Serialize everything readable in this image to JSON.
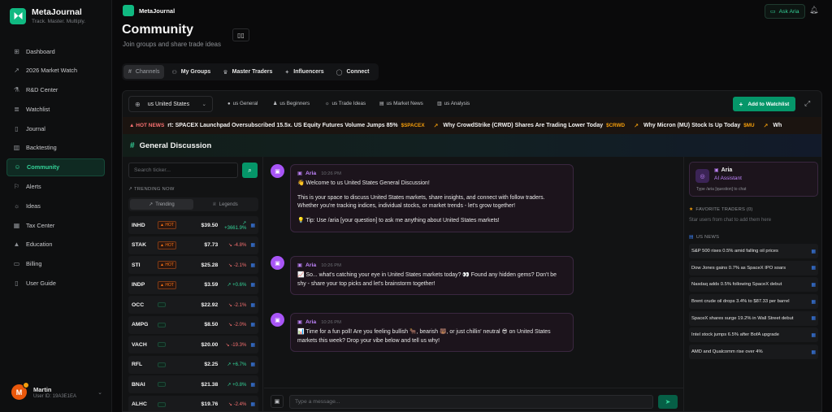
{
  "brand": {
    "name": "MetaJournal",
    "tagline": "Track. Master. Multiply."
  },
  "nav": [
    {
      "label": "Dashboard",
      "icon": "grid-icon",
      "glyph": "⊞"
    },
    {
      "label": "2026 Market Watch",
      "icon": "trend-icon",
      "glyph": "↗"
    },
    {
      "label": "R&D Center",
      "icon": "lab-icon",
      "glyph": "⚗"
    },
    {
      "label": "Watchlist",
      "icon": "list-icon",
      "glyph": "≣"
    },
    {
      "label": "Journal",
      "icon": "book-icon",
      "glyph": "▯"
    },
    {
      "label": "Backtesting",
      "icon": "bar-chart-icon",
      "glyph": "▥"
    },
    {
      "label": "Community",
      "icon": "users-icon",
      "glyph": "☺",
      "active": true
    },
    {
      "label": "Alerts",
      "icon": "bell-icon",
      "glyph": "⚐"
    },
    {
      "label": "Ideas",
      "icon": "bulb-icon",
      "glyph": "☼"
    },
    {
      "label": "Tax Center",
      "icon": "calculator-icon",
      "glyph": "▦"
    },
    {
      "label": "Education",
      "icon": "grad-cap-icon",
      "glyph": "▲"
    },
    {
      "label": "Billing",
      "icon": "card-icon",
      "glyph": "▭"
    },
    {
      "label": "User Guide",
      "icon": "guide-icon",
      "glyph": "▯"
    }
  ],
  "user": {
    "initial": "M",
    "name": "Martin",
    "id": "User ID: 19A3E1EA"
  },
  "topbar": {
    "app_name": "MetaJournal",
    "ask_aria": "Ask Aria"
  },
  "page": {
    "title": "Community",
    "subtitle": "Join groups and share trade ideas"
  },
  "tabs": [
    {
      "label": "Channels",
      "glyph": "#",
      "active": true
    },
    {
      "label": "My Groups",
      "glyph": "⚇"
    },
    {
      "label": "Master Traders",
      "glyph": "♛"
    },
    {
      "label": "Influencers",
      "glyph": "✦"
    },
    {
      "label": "Connect",
      "glyph": "◯"
    }
  ],
  "filters": {
    "country": "us United States",
    "channels": [
      {
        "label": "us General",
        "glyph": "●"
      },
      {
        "label": "us Beginners",
        "glyph": "♟"
      },
      {
        "label": "us Trade Ideas",
        "glyph": "☼"
      },
      {
        "label": "us Market News",
        "glyph": "▤"
      },
      {
        "label": "us Analysis",
        "glyph": "▥"
      }
    ],
    "add_watchlist": "Add to Watchlist"
  },
  "ticker": {
    "hot_label": "HOT NEWS",
    "items": [
      {
        "text": "rt: SPACEX Launchpad Oversubscribed 15.5x. US Equity Futures Volume Jumps 85%",
        "sym": "$SPACEX"
      },
      {
        "text": "Why CrowdStrike (CRWD) Shares Are Trading Lower Today",
        "sym": "$CRWD"
      },
      {
        "text": "Why Micron (MU) Stock Is Up Today",
        "sym": "$MU"
      },
      {
        "text": "Wh",
        "sym": ""
      }
    ]
  },
  "discussion": {
    "title": "General Discussion"
  },
  "search": {
    "placeholder": "Search ticker..."
  },
  "trending": {
    "label": "TRENDING NOW",
    "toggle": [
      "Trending",
      "Legends"
    ],
    "rows": [
      {
        "sym": "INHD",
        "badge": "HOT",
        "price": "$39.50",
        "change": "+3661.9%",
        "dir": "up"
      },
      {
        "sym": "STAK",
        "badge": "HOT",
        "price": "$7.73",
        "change": "-4.8%",
        "dir": "down"
      },
      {
        "sym": "STI",
        "badge": "HOT",
        "price": "$25.28",
        "change": "-2.1%",
        "dir": "down"
      },
      {
        "sym": "INDP",
        "badge": "HOT",
        "price": "$3.59",
        "change": "+0.6%",
        "dir": "up"
      },
      {
        "sym": "OCC",
        "badge": "trend",
        "price": "$22.92",
        "change": "-2.1%",
        "dir": "down"
      },
      {
        "sym": "AMPG",
        "badge": "trend",
        "price": "$8.50",
        "change": "-2.0%",
        "dir": "down"
      },
      {
        "sym": "VACH",
        "badge": "trend",
        "price": "$20.00",
        "change": "-19.3%",
        "dir": "down"
      },
      {
        "sym": "RFL",
        "badge": "trend",
        "price": "$2.25",
        "change": "+6.7%",
        "dir": "up"
      },
      {
        "sym": "BNAI",
        "badge": "trend",
        "price": "$21.38",
        "change": "+0.8%",
        "dir": "up"
      },
      {
        "sym": "ALHC",
        "badge": "trend",
        "price": "$19.76",
        "change": "-2.4%",
        "dir": "down"
      }
    ]
  },
  "messages": [
    {
      "name": "Aria",
      "time": "10:26 PM",
      "paragraphs": [
        "👋 Welcome to us United States General Discussion!",
        "This is your space to discuss United States markets, share insights, and connect with follow traders. Whether you're tracking indices, individual stocks, or market trends - let's grow together!",
        "💡 Tip: Use /aria [your question] to ask me anything about United States markets!"
      ]
    },
    {
      "name": "Aria",
      "time": "10:26 PM",
      "paragraphs": [
        "📈 So... what's catching your eye in United States markets today? 👀 Found any hidden gems? Don't be shy - share your top picks and let's brainstorm together!"
      ]
    },
    {
      "name": "Aria",
      "time": "10:26 PM",
      "paragraphs": [
        "📊 Time for a fun poll! Are you feeling bullish 🐂, bearish 🐻, or just chillin' neutral 😎 on United States markets this week? Drop your vibe below and tell us why!"
      ]
    }
  ],
  "composer": {
    "placeholder": "Type a message..."
  },
  "aria_card": {
    "name": "Aria",
    "role": "AI Assistant",
    "hint": "Type /aria [question] to chat"
  },
  "favorites": {
    "label": "FAVORITE TRADERS (0)",
    "empty": "Star users from chat to add them here"
  },
  "news": {
    "label": "US NEWS",
    "items": [
      "S&P 500 rises 0.5% amid falling oil prices",
      "Dow Jones gains 0.7% as SpaceX IPO soars",
      "Nasdaq adds 0.5% following SpaceX debut",
      "Brent crude oil drops 3.4% to $87.33 per barrel",
      "SpaceX shares surge 19.2% in Wall Street debut",
      "Intel stock jumps 6.5% after BofA upgrade",
      "AMD and Qualcomm rise over 4%"
    ]
  },
  "colors": {
    "accent": "#10b981",
    "aria": "#c084fc",
    "up": "#34d399",
    "down": "#f87171",
    "hot": "#f97316"
  }
}
